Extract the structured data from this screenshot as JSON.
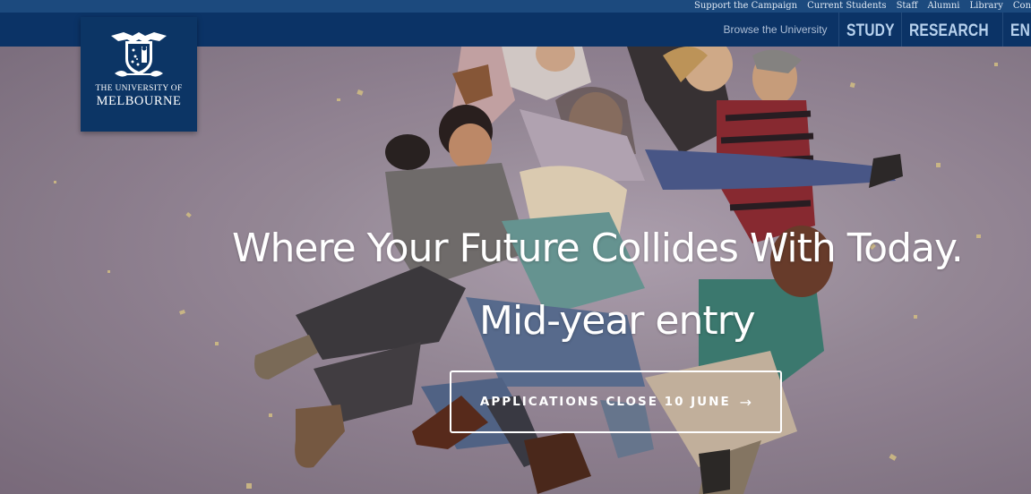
{
  "utility_nav": {
    "links": [
      "Support the Campaign",
      "Current Students",
      "Staff",
      "Alumni",
      "Library",
      "Conta"
    ]
  },
  "main_nav": {
    "browse_label": "Browse the University",
    "links": [
      "STUDY",
      "RESEARCH",
      "EN"
    ]
  },
  "logo": {
    "line1": "THE UNIVERSITY OF",
    "line2": "MELBOURNE",
    "icon": "university-crest-icon"
  },
  "hero": {
    "headline": "Where Your Future Collides With Today.",
    "subheadline": "Mid-year entry",
    "cta_label": "APPLICATIONS CLOSE 10 JUNE",
    "cta_arrow": "→"
  },
  "colors": {
    "utility_bar": "#1c4a7e",
    "nav_bar": "#0b3366",
    "logo_bg": "#0c3565",
    "hero_bg": "#9a8c9b",
    "nav_text": "#b8d2ee"
  }
}
